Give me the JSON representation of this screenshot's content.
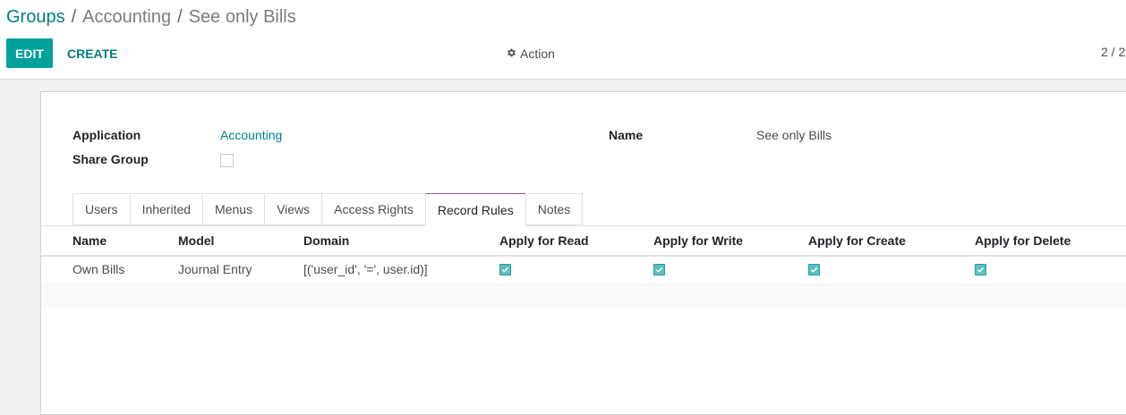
{
  "breadcrumb": {
    "root": "Groups",
    "sep1": "/",
    "middle": "Accounting",
    "sep2": "/",
    "current": "See only Bills"
  },
  "toolbar": {
    "edit_label": "EDIT",
    "create_label": "CREATE",
    "action_label": "Action",
    "action_icon": "gear-icon",
    "pager_text": "2 / 2"
  },
  "form": {
    "application_label": "Application",
    "application_value": "Accounting",
    "share_group_label": "Share Group",
    "share_group_checked": false,
    "name_label": "Name",
    "name_value": "See only Bills"
  },
  "tabs": [
    {
      "label": "Users"
    },
    {
      "label": "Inherited"
    },
    {
      "label": "Menus"
    },
    {
      "label": "Views"
    },
    {
      "label": "Access Rights"
    },
    {
      "label": "Record Rules"
    },
    {
      "label": "Notes"
    }
  ],
  "active_tab": "Record Rules",
  "table": {
    "columns": [
      "Name",
      "Model",
      "Domain",
      "Apply for Read",
      "Apply for Write",
      "Apply for Create",
      "Apply for Delete"
    ],
    "rows": [
      {
        "name": "Own Bills",
        "model": "Journal Entry",
        "domain": "[('user_id', '=', user.id)]",
        "read": true,
        "write": true,
        "create": true,
        "delete": true
      }
    ]
  },
  "colors": {
    "primary": "#00a09d",
    "link": "#017e84",
    "active_tab_border": "#875a7b",
    "checkbox": "#5bc0be"
  }
}
